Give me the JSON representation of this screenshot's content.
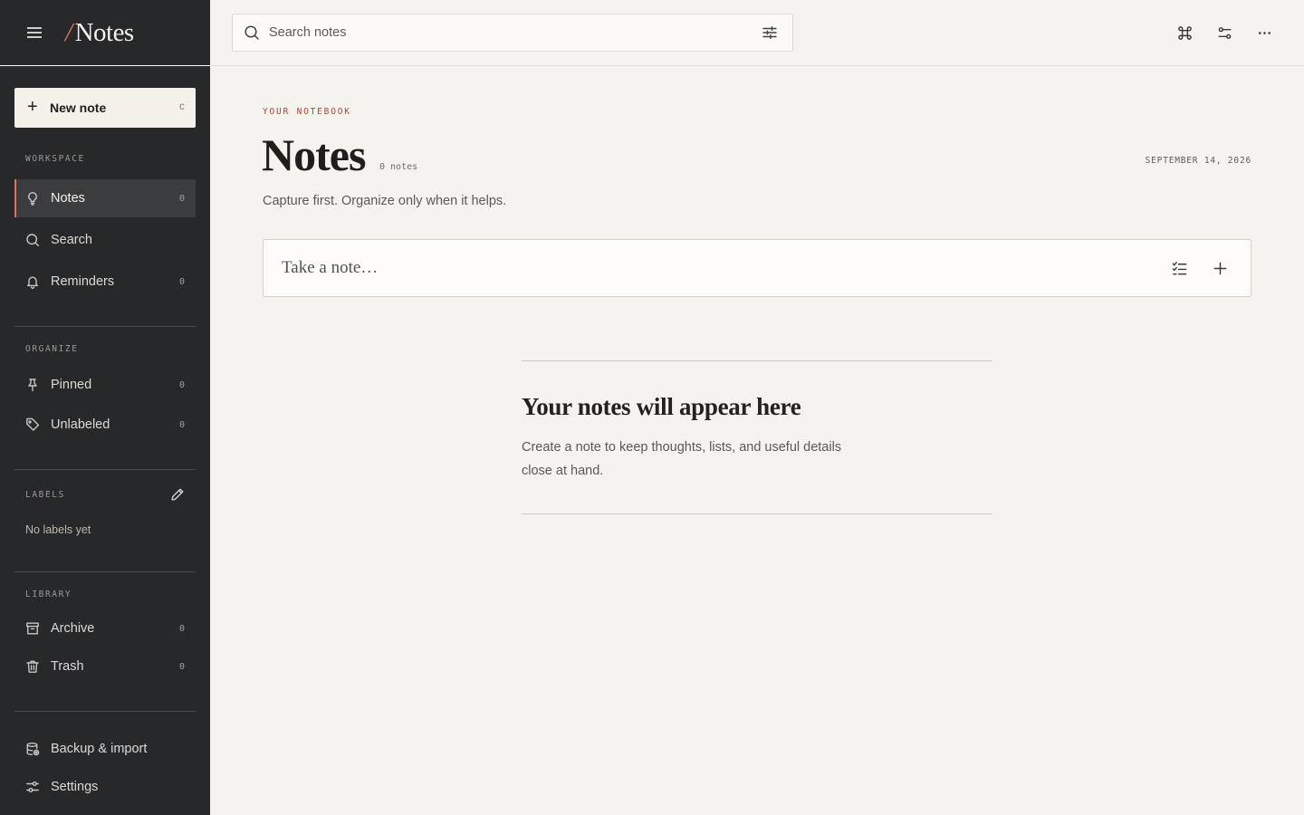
{
  "brand": {
    "slash": "/",
    "name": "Notes"
  },
  "sidebar": {
    "new_note": {
      "label": "New note",
      "shortcut": "C"
    },
    "workspace": {
      "title": "WORKSPACE",
      "items": [
        {
          "label": "Notes",
          "count": "0",
          "icon": "lightbulb-icon",
          "active": true
        },
        {
          "label": "Search",
          "count": "",
          "icon": "search-icon"
        },
        {
          "label": "Reminders",
          "count": "0",
          "icon": "bell-icon"
        }
      ]
    },
    "organize": {
      "title": "ORGANIZE",
      "items": [
        {
          "label": "Pinned",
          "count": "0",
          "icon": "pin-icon"
        },
        {
          "label": "Unlabeled",
          "count": "0",
          "icon": "tag-icon"
        }
      ]
    },
    "labels": {
      "title": "LABELS",
      "empty": "No labels yet"
    },
    "library": {
      "title": "LIBRARY",
      "items": [
        {
          "label": "Archive",
          "count": "0",
          "icon": "archive-icon"
        },
        {
          "label": "Trash",
          "count": "0",
          "icon": "trash-icon"
        }
      ]
    },
    "footer": [
      {
        "label": "Backup & import",
        "icon": "database-icon"
      },
      {
        "label": "Settings",
        "icon": "sliders-icon"
      }
    ]
  },
  "topbar": {
    "search_placeholder": "Search notes",
    "actions": [
      "command-icon",
      "toggle-icon",
      "more-icon"
    ]
  },
  "main": {
    "eyebrow": "YOUR NOTEBOOK",
    "title": "Notes",
    "note_count": "0 notes",
    "date": "SEPTEMBER 14, 2026",
    "subtitle": "Capture first. Organize only when it helps.",
    "composer_placeholder": "Take a note…",
    "empty_title": "Your notes will appear here",
    "empty_text": "Create a note to keep thoughts, lists, and useful details close at hand."
  },
  "colors": {
    "accent": "#d8755b",
    "sidebar_bg": "#27282a",
    "page_bg": "#f5f3ee",
    "eyebrow": "#b2442f"
  }
}
